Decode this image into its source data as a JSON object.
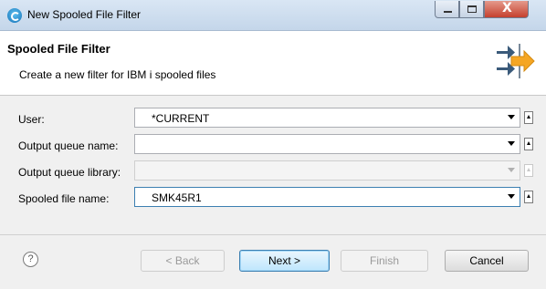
{
  "window": {
    "title": "New Spooled File Filter",
    "controls": {
      "minimize": "minimize-icon",
      "maximize": "maximize-icon",
      "close": "X"
    }
  },
  "banner": {
    "title": "Spooled File Filter",
    "description": "Create a new filter for IBM i spooled files",
    "image": "filter-wizard-icon"
  },
  "form": {
    "fields": [
      {
        "label": "User:",
        "value": "*CURRENT",
        "enabled": true
      },
      {
        "label": "Output queue name:",
        "value": "",
        "enabled": true
      },
      {
        "label": "Output queue library:",
        "value": "",
        "enabled": false
      },
      {
        "label": "Spooled file name:",
        "value": "SMK45R1",
        "enabled": true
      }
    ]
  },
  "footer": {
    "help_glyph": "?",
    "buttons": {
      "back": "< Back",
      "next": "Next >",
      "finish": "Finish",
      "cancel": "Cancel"
    }
  }
}
